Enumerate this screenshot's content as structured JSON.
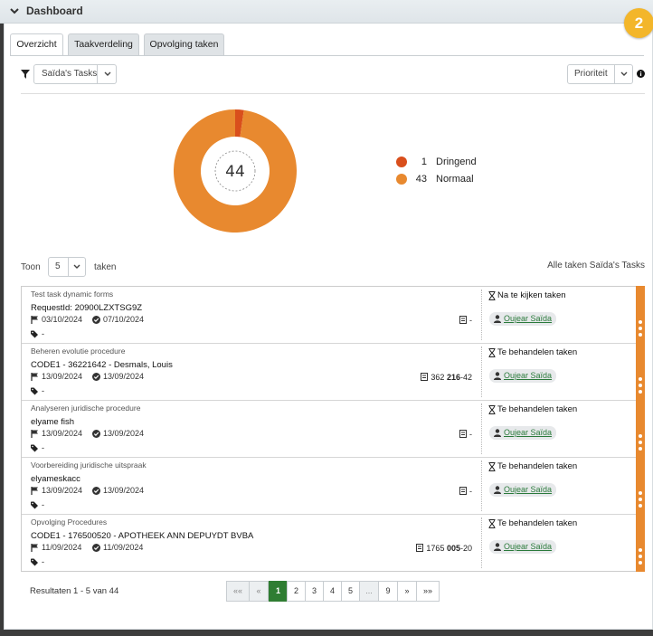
{
  "header": {
    "title": "Dashboard"
  },
  "badge": {
    "number": "2",
    "color": "#f3b62a"
  },
  "tabs": [
    {
      "label": "Overzicht",
      "active": true
    },
    {
      "label": "Taakverdeling",
      "active": false
    },
    {
      "label": "Opvolging taken",
      "active": false
    }
  ],
  "filter": {
    "selected": "Saïda's Tasks"
  },
  "sort": {
    "selected": "Prioriteit"
  },
  "chart_data": {
    "type": "pie",
    "title": "",
    "center_label": "44",
    "categories": [
      "Dringend",
      "Normaal"
    ],
    "values": [
      1,
      43
    ],
    "colors": [
      "#d94f1c",
      "#e8892f"
    ],
    "legend_position": "right"
  },
  "legend": [
    {
      "count": "1",
      "label": "Dringend",
      "color": "#d94f1c"
    },
    {
      "count": "43",
      "label": "Normaal",
      "color": "#e8892f"
    }
  ],
  "list_controls": {
    "toon_label": "Toon",
    "page_size": "5",
    "taken_label": "taken",
    "all_link": "Alle taken Saïda's Tasks"
  },
  "tasks": [
    {
      "procedure": "Test task dynamic forms",
      "subject": "RequestId: 20900LZXTSG9Z",
      "start": "03/10/2024",
      "due": "07/10/2024",
      "tags": "-",
      "ref_pre": "",
      "ref_bold": "",
      "ref_post": "-",
      "status": "Na te kijken taken",
      "user": "Oujear Saïda"
    },
    {
      "procedure": "Beheren evolutie procedure",
      "subject": "CODE1 - 36221642 - Desmals, Louis",
      "start": "13/09/2024",
      "due": "13/09/2024",
      "tags": "-",
      "ref_pre": "362 ",
      "ref_bold": "216",
      "ref_post": "-42",
      "status": "Te behandelen taken",
      "user": "Oujear Saïda"
    },
    {
      "procedure": "Analyseren juridische procedure",
      "subject": "elyame fish",
      "start": "13/09/2024",
      "due": "13/09/2024",
      "tags": "-",
      "ref_pre": "",
      "ref_bold": "",
      "ref_post": "-",
      "status": "Te behandelen taken",
      "user": "Oujear Saïda"
    },
    {
      "procedure": "Voorbereiding juridische uitspraak",
      "subject": "elyameskacc",
      "start": "13/09/2024",
      "due": "13/09/2024",
      "tags": "-",
      "ref_pre": "",
      "ref_bold": "",
      "ref_post": "-",
      "status": "Te behandelen taken",
      "user": "Oujear Saïda"
    },
    {
      "procedure": "Opvolging Procedures",
      "subject": "CODE1 - 176500520 - APOTHEEK ANN DEPUYDT BVBA",
      "start": "11/09/2024",
      "due": "11/09/2024",
      "tags": "-",
      "ref_pre": "1765 ",
      "ref_bold": "005",
      "ref_post": "-20",
      "status": "Te behandelen taken",
      "user": "Oujear Saïda"
    }
  ],
  "pagination": {
    "results_text": "Resultaten 1 - 5 van 44",
    "first": "««",
    "prev": "«",
    "pages": [
      "1",
      "2",
      "3",
      "4",
      "5"
    ],
    "ellipsis": "...",
    "last_page": "9",
    "next": "»",
    "last": "»»",
    "current": "1"
  }
}
